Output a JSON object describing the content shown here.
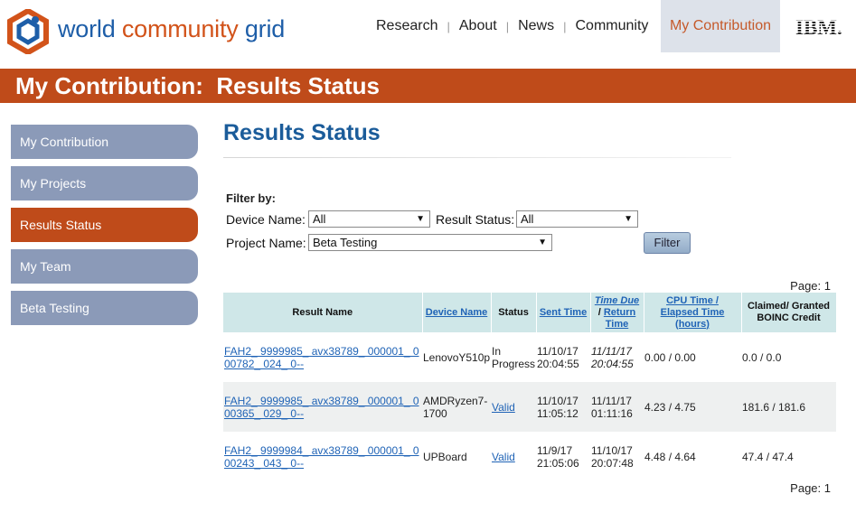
{
  "header": {
    "logo_text_main": "world ",
    "logo_text_accent": "community",
    "logo_text_end": " grid",
    "nav": [
      "Research",
      "About",
      "News",
      "Community"
    ],
    "nav_active": "My Contribution",
    "partner_logo": "IBM."
  },
  "titlebar": "My Contribution:  Results Status",
  "sidebar": {
    "items": [
      {
        "label": "My Contribution"
      },
      {
        "label": "My Projects"
      },
      {
        "label": "Results Status"
      },
      {
        "label": "My Team"
      },
      {
        "label": "Beta Testing"
      }
    ],
    "active_index": 2
  },
  "main": {
    "heading": "Results Status",
    "filter": {
      "title": "Filter by:",
      "device_label": "Device Name:",
      "device_value": "All",
      "status_label": "Result Status:",
      "status_value": "All",
      "project_label": "Project Name:",
      "project_value": "Beta Testing",
      "button": "Filter"
    },
    "pager_top": "Page: 1",
    "pager_bottom": "Page: 1",
    "table": {
      "headers": {
        "result_name": "Result Name",
        "device_name": "Device Name",
        "status": "Status",
        "sent_time": "Sent Time",
        "time_due": "Time Due",
        "return_time": "Return Time",
        "cpu_time": "CPU Time / Elapsed Time (hours)",
        "credit": "Claimed/ Granted BOINC Credit"
      },
      "rows": [
        {
          "result_name": "FAH2_ 9999985_ avx38789_ 000001_ 000782_ 024_ 0--",
          "device": "LenovoY510p",
          "status": "In Progress",
          "sent_date": "11/10/17",
          "sent_time": "20:04:55",
          "due_date": "11/11/17",
          "due_time": "20:04:55",
          "cpu": "0.00 / 0.00",
          "credit": "0.0 / 0.0"
        },
        {
          "result_name": "FAH2_ 9999985_ avx38789_ 000001_ 000365_ 029_ 0--",
          "device": "AMDRyzen7-1700",
          "status": "Valid",
          "sent_date": "11/10/17",
          "sent_time": "11:05:12",
          "due_date": "11/11/17",
          "due_time": "01:11:16",
          "cpu": "4.23 / 4.75",
          "credit": "181.6 / 181.6"
        },
        {
          "result_name": "FAH2_ 9999984_ avx38789_ 000001_ 000243_ 043_ 0--",
          "device": "UPBoard",
          "status": "Valid",
          "sent_date": "11/9/17",
          "sent_time": "21:05:06",
          "due_date": "11/10/17",
          "due_time": "20:07:48",
          "cpu": "4.48 / 4.64",
          "credit": "47.4 / 47.4"
        }
      ]
    }
  },
  "colors": {
    "brand_orange": "#bf4b1a",
    "brand_blue": "#1b5c9a",
    "sidebar_blue": "#8b9ab8",
    "table_header": "#cfe7e8"
  }
}
